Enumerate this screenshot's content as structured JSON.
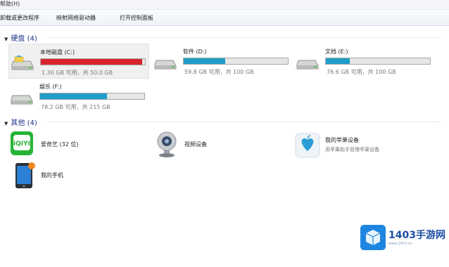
{
  "menubar": {
    "help_label": "帮助(H)"
  },
  "toolbar": {
    "uninstall_label": "卸载或更改程序",
    "map_drive_label": "映射网络驱动器",
    "control_panel_label": "打开控制面板"
  },
  "groups": {
    "hard_disks": {
      "title": "硬盘 (4)"
    },
    "others": {
      "title": "其他 (4)"
    }
  },
  "drives": [
    {
      "name": "本地磁盘 (C:)",
      "stats": "1.30 GB 可用，共 50.0 GB",
      "used_percent": 97,
      "bar_color": "#d9232d",
      "selected": true
    },
    {
      "name": "软件 (D:)",
      "stats": "59.8 GB 可用，共 100 GB",
      "used_percent": 40,
      "bar_color": "#1e9ec9",
      "selected": false
    },
    {
      "name": "文档 (E:)",
      "stats": "76.6 GB 可用，共 100 GB",
      "used_percent": 23,
      "bar_color": "#1e9ec9",
      "selected": false
    },
    {
      "name": "娱乐 (F:)",
      "stats": "78.2 GB 可用，共 215 GB",
      "used_percent": 64,
      "bar_color": "#1e9ec9",
      "selected": false
    }
  ],
  "other_items": [
    {
      "name": "爱奇艺 (32 位)",
      "icon": "iqiyi-icon"
    },
    {
      "name": "视频设备",
      "icon": "webcam-icon"
    },
    {
      "name": "我的苹果设备",
      "subtitle": "用苹果助手管理苹果设备",
      "icon": "apple-device-icon"
    },
    {
      "name": "我的手机",
      "icon": "phone-icon"
    }
  ],
  "watermark": {
    "text": "1403手游网",
    "url": "www.1403.cn",
    "logo_text": "iQIYI"
  },
  "colors": {
    "critical_bar": "#d9232d",
    "normal_bar": "#1e9ec9",
    "header_text": "#1e3287"
  }
}
